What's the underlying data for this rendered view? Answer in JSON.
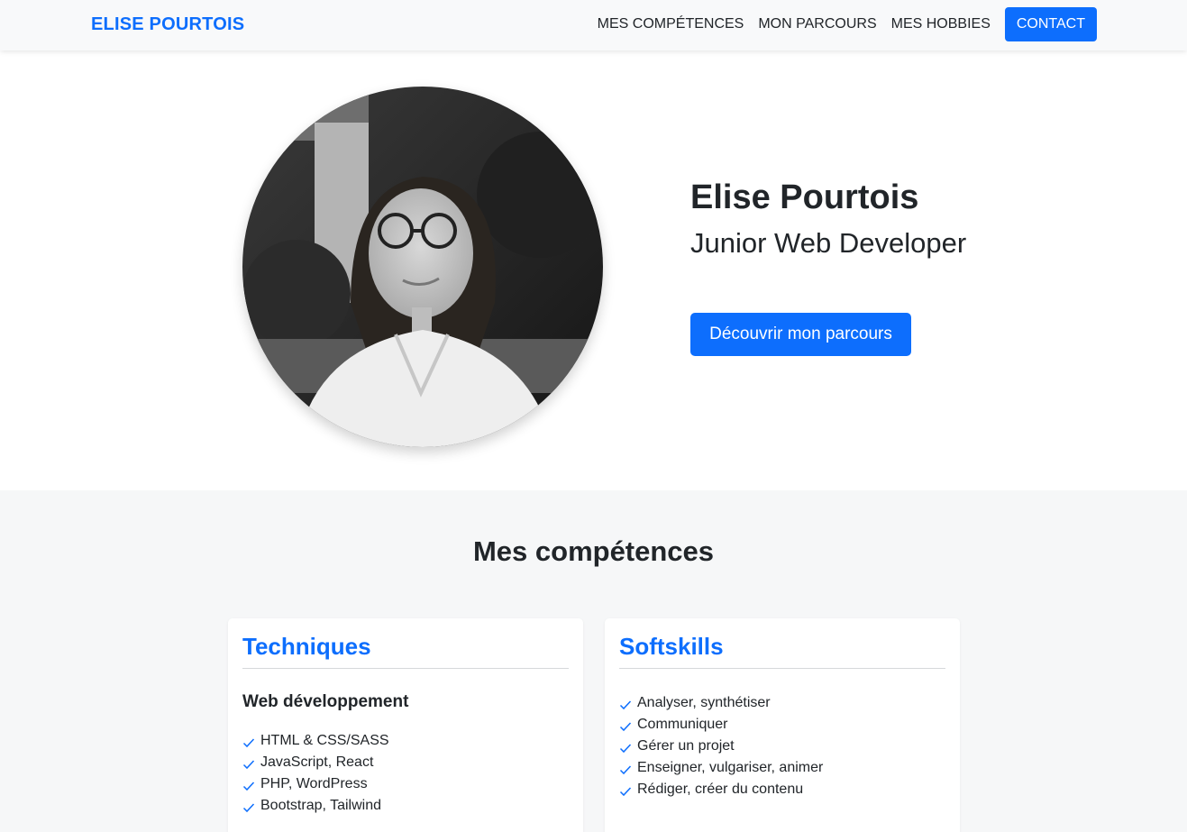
{
  "navbar": {
    "brand": "ELISE POURTOIS",
    "links": [
      "MES COMPÉTENCES",
      "MON PARCOURS",
      "MES HOBBIES"
    ],
    "contact": "CONTACT"
  },
  "hero": {
    "name": "Elise Pourtois",
    "role": "Junior Web Developer",
    "button": "Découvrir mon parcours"
  },
  "skills": {
    "title": "Mes compétences",
    "techniques": {
      "title": "Techniques",
      "subtitle": "Web développement",
      "items": [
        "HTML & CSS/SASS",
        "JavaScript, React",
        "PHP, WordPress",
        "Bootstrap, Tailwind"
      ]
    },
    "softskills": {
      "title": "Softskills",
      "items": [
        "Analyser, synthétiser",
        "Communiquer",
        "Gérer un projet",
        "Enseigner, vulgariser, animer",
        "Rédiger, créer du contenu"
      ]
    }
  },
  "colors": {
    "accent": "#0d6efd",
    "text": "#212529",
    "section_bg": "#f6f7f8"
  },
  "icons": {
    "list_bullet": "check-icon"
  }
}
